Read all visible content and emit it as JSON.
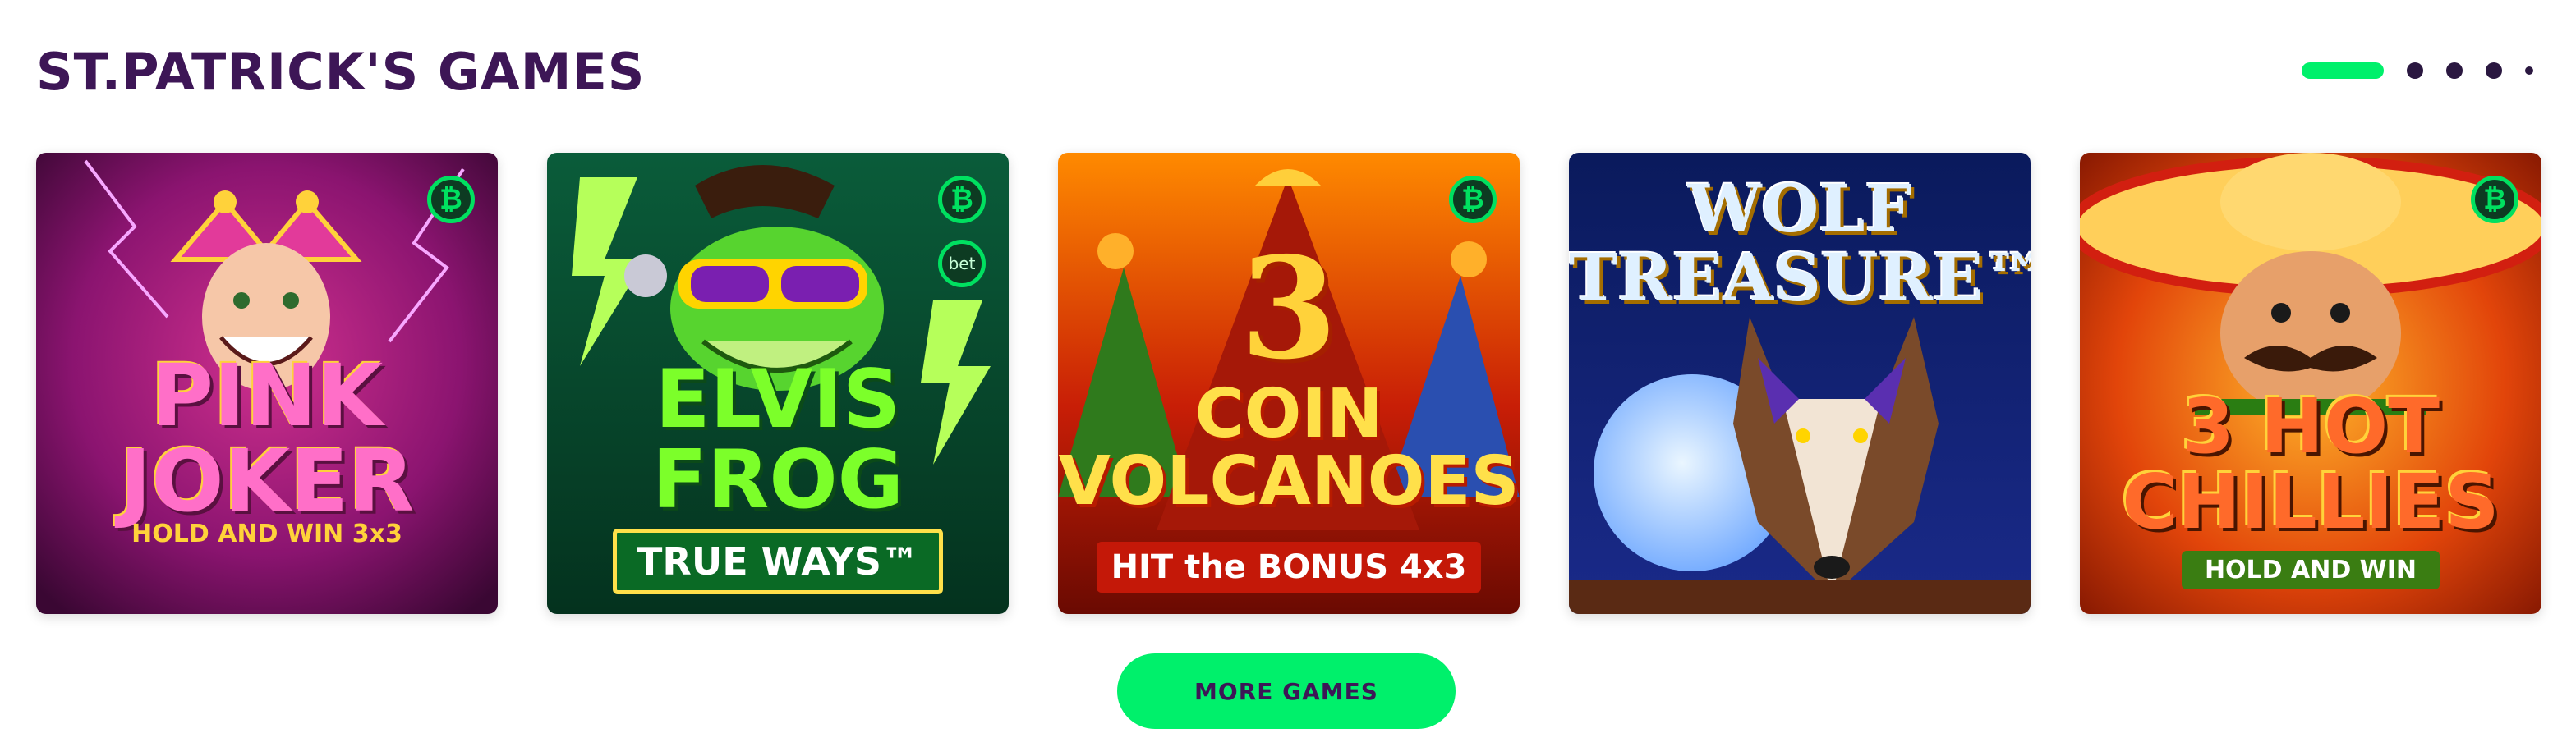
{
  "section": {
    "title": "ST.PATRICK'S GAMES"
  },
  "pager": {
    "pages": 5,
    "active_index": 0
  },
  "games": [
    {
      "name": "PINK JOKER",
      "subtitle": "HOLD AND WIN 3x3",
      "badge": "₿",
      "badge_icon": "bitcoin-icon"
    },
    {
      "name": "ELVIS FROG",
      "subtitle": "TRUE WAYS™",
      "badge": "₿",
      "badge_icon": "bitcoin-icon",
      "second_badge": "bet",
      "second_badge_icon": "bet-icon"
    },
    {
      "number": "3",
      "name": "COIN VOLCANOES",
      "subtitle": "HIT the BONUS 4x3",
      "badge": "₿",
      "badge_icon": "bitcoin-icon"
    },
    {
      "name": "WOLF TREASURE™"
    },
    {
      "name": "3 HOT CHILLIES",
      "subtitle": "HOLD AND WIN",
      "badge": "₿",
      "badge_icon": "bitcoin-icon"
    }
  ],
  "more_button": {
    "label": "MORE GAMES"
  },
  "colors": {
    "accent": "#00f06b",
    "title": "#3d1656",
    "pager_dot": "#2a1740"
  }
}
